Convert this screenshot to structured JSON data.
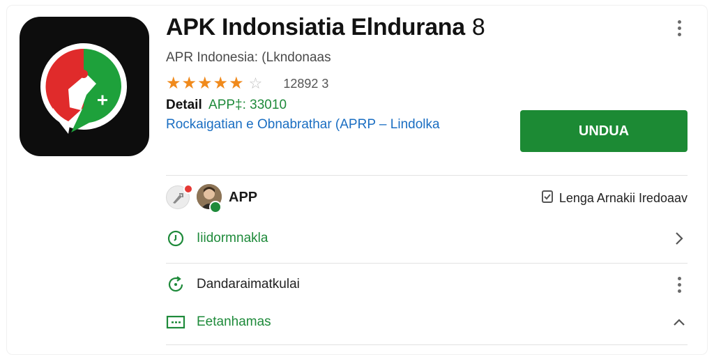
{
  "app": {
    "title": "APK Indonsiatia Elndurana",
    "title_number": "8",
    "developer": "APR Indonesia: (Lkndonaas",
    "rating_count": "12892 3",
    "detail_label": "Detail",
    "detail_value": "APP‡: 33010",
    "link_text": "Rockaigatian e Obnabrathar (APRP – Lindolka",
    "install_label": "UNDUA"
  },
  "meta": {
    "label": "APP",
    "info_link": "Lenga Arnakii Iredoaav"
  },
  "rows": [
    {
      "label": "Iiidormnakla",
      "icon": "clock-icon",
      "trail": "chevron-right-icon"
    },
    {
      "label": "Dandaraimatkulai",
      "icon": "refresh-icon",
      "trail": "more-vert-icon"
    },
    {
      "label": "Eetanhamas",
      "icon": "message-icon",
      "trail": "chevron-up-icon"
    }
  ],
  "colors": {
    "brand_green": "#1c8a34",
    "star_orange": "#f08a1c",
    "link_blue": "#1a6ec2"
  }
}
